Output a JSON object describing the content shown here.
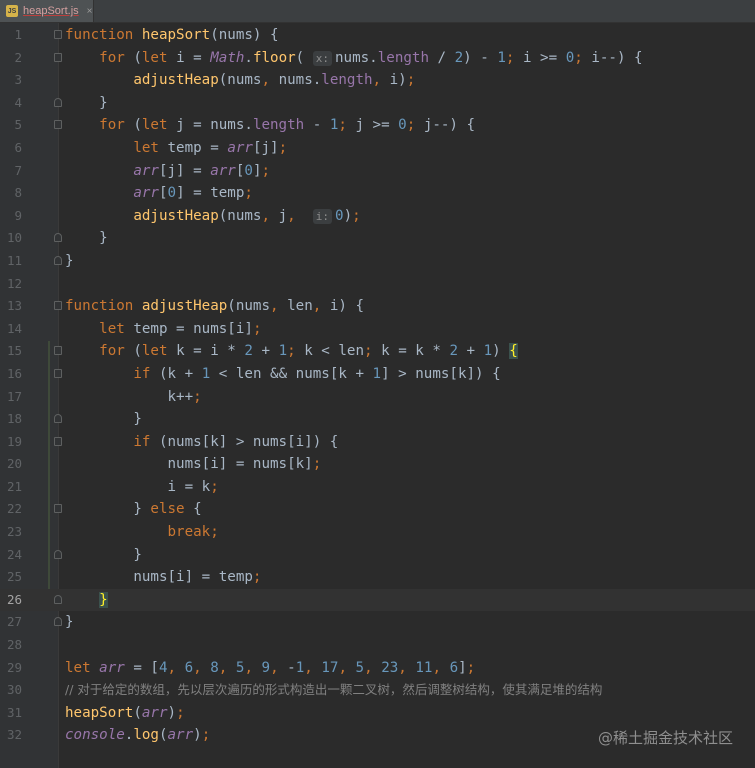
{
  "tab": {
    "icon": "js-file-icon",
    "icon_text": "JS",
    "filename": "heapSort.js",
    "close": "×"
  },
  "current_line": 26,
  "lines": [
    {
      "n": "1",
      "fold": "start",
      "t": [
        [
          "k",
          "function "
        ],
        [
          "f",
          "heapSort"
        ],
        [
          "d",
          "(nums) {"
        ]
      ]
    },
    {
      "n": "2",
      "fold": "start",
      "t": [
        [
          "d",
          "    "
        ],
        [
          "k",
          "for "
        ],
        [
          "d",
          "("
        ],
        [
          "k",
          "let "
        ],
        [
          "d",
          "i = "
        ],
        [
          "g",
          "Math"
        ],
        [
          "d",
          "."
        ],
        [
          "f",
          "floor"
        ],
        [
          "d",
          "( "
        ],
        [
          "h",
          "x:"
        ],
        [
          "d",
          "nums."
        ],
        [
          "p",
          "length"
        ],
        [
          "d",
          " / "
        ],
        [
          "n",
          "2"
        ],
        [
          "d",
          ") - "
        ],
        [
          "n",
          "1"
        ],
        [
          "k",
          "; "
        ],
        [
          "d",
          "i >= "
        ],
        [
          "n",
          "0"
        ],
        [
          "k",
          "; "
        ],
        [
          "d",
          "i--) {"
        ]
      ]
    },
    {
      "n": "3",
      "fold": "",
      "t": [
        [
          "d",
          "        "
        ],
        [
          "f",
          "adjustHeap"
        ],
        [
          "d",
          "(nums"
        ],
        [
          "k",
          ", "
        ],
        [
          "d",
          "nums."
        ],
        [
          "p",
          "length"
        ],
        [
          "k",
          ", "
        ],
        [
          "d",
          "i)"
        ],
        [
          "k",
          ";"
        ]
      ]
    },
    {
      "n": "4",
      "fold": "end",
      "t": [
        [
          "d",
          "    }"
        ]
      ]
    },
    {
      "n": "5",
      "fold": "start",
      "t": [
        [
          "d",
          "    "
        ],
        [
          "k",
          "for "
        ],
        [
          "d",
          "("
        ],
        [
          "k",
          "let "
        ],
        [
          "d",
          "j = nums."
        ],
        [
          "p",
          "length"
        ],
        [
          "d",
          " - "
        ],
        [
          "n",
          "1"
        ],
        [
          "k",
          "; "
        ],
        [
          "d",
          "j >= "
        ],
        [
          "n",
          "0"
        ],
        [
          "k",
          "; "
        ],
        [
          "d",
          "j--) {"
        ]
      ]
    },
    {
      "n": "6",
      "fold": "",
      "t": [
        [
          "d",
          "        "
        ],
        [
          "k",
          "let "
        ],
        [
          "d",
          "temp = "
        ],
        [
          "g",
          "arr"
        ],
        [
          "d",
          "[j]"
        ],
        [
          "k",
          ";"
        ]
      ]
    },
    {
      "n": "7",
      "fold": "",
      "t": [
        [
          "d",
          "        "
        ],
        [
          "g",
          "arr"
        ],
        [
          "d",
          "[j] = "
        ],
        [
          "g",
          "arr"
        ],
        [
          "d",
          "["
        ],
        [
          "n",
          "0"
        ],
        [
          "d",
          "]"
        ],
        [
          "k",
          ";"
        ]
      ]
    },
    {
      "n": "8",
      "fold": "",
      "t": [
        [
          "d",
          "        "
        ],
        [
          "g",
          "arr"
        ],
        [
          "d",
          "["
        ],
        [
          "n",
          "0"
        ],
        [
          "d",
          "] = temp"
        ],
        [
          "k",
          ";"
        ]
      ]
    },
    {
      "n": "9",
      "fold": "",
      "t": [
        [
          "d",
          "        "
        ],
        [
          "f",
          "adjustHeap"
        ],
        [
          "d",
          "(nums"
        ],
        [
          "k",
          ", "
        ],
        [
          "d",
          "j"
        ],
        [
          "k",
          ", "
        ],
        [
          "d",
          " "
        ],
        [
          "h",
          "i:"
        ],
        [
          "n",
          "0"
        ],
        [
          "d",
          ")"
        ],
        [
          "k",
          ";"
        ]
      ]
    },
    {
      "n": "10",
      "fold": "end",
      "t": [
        [
          "d",
          "    }"
        ]
      ]
    },
    {
      "n": "11",
      "fold": "end",
      "t": [
        [
          "d",
          "}"
        ]
      ]
    },
    {
      "n": "12",
      "fold": "",
      "t": []
    },
    {
      "n": "13",
      "fold": "start",
      "t": [
        [
          "k",
          "function "
        ],
        [
          "f",
          "adjustHeap"
        ],
        [
          "d",
          "(nums"
        ],
        [
          "k",
          ", "
        ],
        [
          "d",
          "len"
        ],
        [
          "k",
          ", "
        ],
        [
          "d",
          "i) {"
        ]
      ]
    },
    {
      "n": "14",
      "fold": "",
      "t": [
        [
          "d",
          "    "
        ],
        [
          "k",
          "let "
        ],
        [
          "d",
          "temp = nums[i]"
        ],
        [
          "k",
          ";"
        ]
      ]
    },
    {
      "n": "15",
      "fold": "start",
      "t": [
        [
          "d",
          "    "
        ],
        [
          "k",
          "for "
        ],
        [
          "d",
          "("
        ],
        [
          "k",
          "let "
        ],
        [
          "d",
          "k = i * "
        ],
        [
          "n",
          "2"
        ],
        [
          "d",
          " + "
        ],
        [
          "n",
          "1"
        ],
        [
          "k",
          "; "
        ],
        [
          "d",
          "k < len"
        ],
        [
          "k",
          "; "
        ],
        [
          "d",
          "k = k * "
        ],
        [
          "n",
          "2"
        ],
        [
          "d",
          " + "
        ],
        [
          "n",
          "1"
        ],
        [
          "d",
          ") "
        ],
        [
          "b",
          "{"
        ]
      ]
    },
    {
      "n": "16",
      "fold": "start",
      "t": [
        [
          "d",
          "        "
        ],
        [
          "k",
          "if "
        ],
        [
          "d",
          "(k + "
        ],
        [
          "n",
          "1"
        ],
        [
          "d",
          " < len && nums[k + "
        ],
        [
          "n",
          "1"
        ],
        [
          "d",
          "] > nums[k]) {"
        ]
      ]
    },
    {
      "n": "17",
      "fold": "",
      "t": [
        [
          "d",
          "            k++"
        ],
        [
          "k",
          ";"
        ]
      ]
    },
    {
      "n": "18",
      "fold": "end",
      "t": [
        [
          "d",
          "        }"
        ]
      ]
    },
    {
      "n": "19",
      "fold": "start",
      "t": [
        [
          "d",
          "        "
        ],
        [
          "k",
          "if "
        ],
        [
          "d",
          "(nums[k] > nums[i]) {"
        ]
      ]
    },
    {
      "n": "20",
      "fold": "",
      "t": [
        [
          "d",
          "            nums[i] = nums[k]"
        ],
        [
          "k",
          ";"
        ]
      ]
    },
    {
      "n": "21",
      "fold": "",
      "t": [
        [
          "d",
          "            i = k"
        ],
        [
          "k",
          ";"
        ]
      ]
    },
    {
      "n": "22",
      "fold": "start",
      "t": [
        [
          "d",
          "        } "
        ],
        [
          "k",
          "else "
        ],
        [
          "d",
          "{"
        ]
      ]
    },
    {
      "n": "23",
      "fold": "",
      "t": [
        [
          "d",
          "            "
        ],
        [
          "k",
          "break;"
        ]
      ]
    },
    {
      "n": "24",
      "fold": "end",
      "t": [
        [
          "d",
          "        }"
        ]
      ]
    },
    {
      "n": "25",
      "fold": "",
      "t": [
        [
          "d",
          "        nums[i] = temp"
        ],
        [
          "k",
          ";"
        ]
      ]
    },
    {
      "n": "26",
      "fold": "end",
      "t": [
        [
          "d",
          "    "
        ],
        [
          "b",
          "}"
        ]
      ]
    },
    {
      "n": "27",
      "fold": "end",
      "t": [
        [
          "d",
          "}"
        ]
      ]
    },
    {
      "n": "28",
      "fold": "",
      "t": []
    },
    {
      "n": "29",
      "fold": "",
      "t": [
        [
          "k",
          "let "
        ],
        [
          "g",
          "arr"
        ],
        [
          "d",
          " = ["
        ],
        [
          "n",
          "4"
        ],
        [
          "k",
          ", "
        ],
        [
          "n",
          "6"
        ],
        [
          "k",
          ", "
        ],
        [
          "n",
          "8"
        ],
        [
          "k",
          ", "
        ],
        [
          "n",
          "5"
        ],
        [
          "k",
          ", "
        ],
        [
          "n",
          "9"
        ],
        [
          "k",
          ", "
        ],
        [
          "d",
          "-"
        ],
        [
          "n",
          "1"
        ],
        [
          "k",
          ", "
        ],
        [
          "n",
          "17"
        ],
        [
          "k",
          ", "
        ],
        [
          "n",
          "5"
        ],
        [
          "k",
          ", "
        ],
        [
          "n",
          "23"
        ],
        [
          "k",
          ", "
        ],
        [
          "n",
          "11"
        ],
        [
          "k",
          ", "
        ],
        [
          "n",
          "6"
        ],
        [
          "d",
          "]"
        ],
        [
          "k",
          ";"
        ]
      ]
    },
    {
      "n": "30",
      "fold": "",
      "t": [
        [
          "c",
          "// 对于给定的数组，先以层次遍历的形式构造出一颗二叉树，然后调整树结构，使其满足堆的结构"
        ]
      ]
    },
    {
      "n": "31",
      "fold": "",
      "t": [
        [
          "f",
          "heapSort"
        ],
        [
          "d",
          "("
        ],
        [
          "g",
          "arr"
        ],
        [
          "d",
          ")"
        ],
        [
          "k",
          ";"
        ]
      ]
    },
    {
      "n": "32",
      "fold": "",
      "t": [
        [
          "g",
          "console"
        ],
        [
          "d",
          "."
        ],
        [
          "f",
          "log"
        ],
        [
          "d",
          "("
        ],
        [
          "g",
          "arr"
        ],
        [
          "d",
          ")"
        ],
        [
          "k",
          ";"
        ]
      ]
    }
  ],
  "watermark": "@稀土掘金技术社区"
}
